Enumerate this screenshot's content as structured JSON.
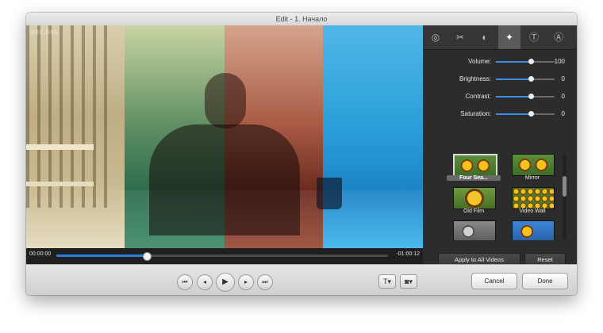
{
  "window": {
    "title": "Edit - 1. Начало"
  },
  "video": {
    "watermark": "BBC ONE"
  },
  "scrubber": {
    "current_time": "00:00:00",
    "remaining_time": "-01:00:12",
    "progress": 0.27
  },
  "panel": {
    "tabs": [
      {
        "icon": "color-wheel-icon"
      },
      {
        "icon": "crop-icon"
      },
      {
        "icon": "exposure-icon"
      },
      {
        "icon": "magic-wand-icon",
        "active": true
      },
      {
        "icon": "text-icon"
      },
      {
        "icon": "font-icon"
      }
    ],
    "adjustments": [
      {
        "label": "Volume:",
        "value": "100",
        "level": 0.6
      },
      {
        "label": "Brightness:",
        "value": "0",
        "level": 0.6
      },
      {
        "label": "Contrast:",
        "value": "0",
        "level": 0.6
      },
      {
        "label": "Saturation:",
        "value": "0",
        "level": 0.6
      }
    ],
    "effects": [
      {
        "label": "Four Sea...",
        "selected": true,
        "style": "normal"
      },
      {
        "label": "Mirror",
        "selected": false,
        "style": "normal"
      },
      {
        "label": "Old Film",
        "selected": false,
        "style": "old"
      },
      {
        "label": "Video Wall",
        "selected": false,
        "style": "wall"
      },
      {
        "label": "",
        "selected": false,
        "style": "gray"
      },
      {
        "label": "",
        "selected": false,
        "style": "blue"
      }
    ],
    "apply_all_label": "Apply to All Videos",
    "reset_label": "Reset"
  },
  "toolbar": {
    "prev_clip_icon": "⏮",
    "step_back_icon": "◂",
    "play_icon": "▶",
    "step_forward_icon": "▸",
    "next_clip_icon": "⏭",
    "text_menu_label": "T▾",
    "snapshot_menu_label": "◙▾",
    "cancel_label": "Cancel",
    "done_label": "Done"
  }
}
